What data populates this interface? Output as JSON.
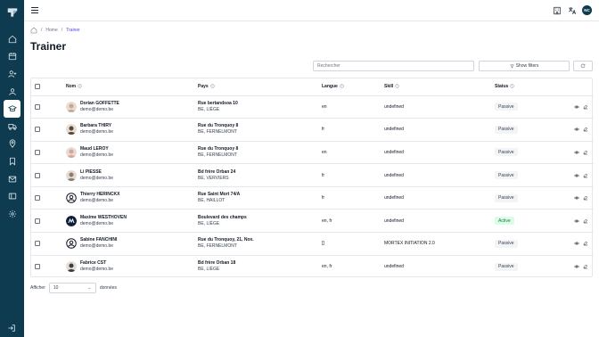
{
  "breadcrumb": {
    "home": "Home",
    "current": "Trainer"
  },
  "page": {
    "title": "Trainer"
  },
  "toolbar": {
    "search_placeholder": "Rechercher",
    "filters_label": "Show filters"
  },
  "table": {
    "columns": {
      "name": "Nom",
      "country": "Pays",
      "language": "Langue",
      "skill": "Skill",
      "status": "Status"
    },
    "rows": [
      {
        "name": "Dorian GOFFETTE",
        "email": "demo@demo.be",
        "addr1": "Rue bertandsoa 10",
        "addr2": "BE, LIÈGE",
        "language": "en",
        "skill": "undefined",
        "status": "Passive",
        "avatar": "photo",
        "avatar_color": "#c9a78f"
      },
      {
        "name": "Barbara THIRY",
        "email": "demo@demo.be",
        "addr1": "Rue du Tronquoy 8",
        "addr2": "BE, FERNELMONT",
        "language": "fr",
        "skill": "undefined",
        "status": "Passive",
        "avatar": "photo",
        "avatar_color": "#5b4636"
      },
      {
        "name": "Maud LEROY",
        "email": "demo@demo.be",
        "addr1": "Rue du Tronquoy 8",
        "addr2": "BE, FERNELMONT",
        "language": "en",
        "skill": "undefined",
        "status": "Passive",
        "avatar": "photo",
        "avatar_color": "#d9a39a"
      },
      {
        "name": "Li PIESSE",
        "email": "demo@demo.be",
        "addr1": "Bd frère Orban 24",
        "addr2": "BE, VERVIERS",
        "language": "fr",
        "skill": "undefined",
        "status": "Passive",
        "avatar": "photo",
        "avatar_color": "#8a7f72"
      },
      {
        "name": "Thierry HERINCKX",
        "email": "demo@demo.be",
        "addr1": "Rue Saint Mort 74/A",
        "addr2": "BE, HAILLOT",
        "language": "fr",
        "skill": "undefined",
        "status": "Passive",
        "avatar": "placeholder",
        "avatar_color": "#111827"
      },
      {
        "name": "Maxime WESTHOVEN",
        "email": "demo@demo.be",
        "addr1": "Boulevard des champs",
        "addr2": "BE, LIÈGE",
        "language": "en, fr",
        "skill": "undefined",
        "status": "Active",
        "avatar": "logo",
        "avatar_color": "#0f1d3a"
      },
      {
        "name": "Sabine FANCHINI",
        "email": "demo@demo.be",
        "addr1": "Rue du Tronquoy, 21, Nox.",
        "addr2": "BE, FERNELMONT",
        "language": "[]",
        "skill": "MORTEX INITIATION 2.0",
        "status": "Passive",
        "avatar": "placeholder",
        "avatar_color": "#111827"
      },
      {
        "name": "Fabrice CST",
        "email": "demo@demo.be",
        "addr1": "Bd frère Orban 18",
        "addr2": "BE, LIÈGE",
        "language": "en, fr",
        "skill": "undefined",
        "status": "Passive",
        "avatar": "photo",
        "avatar_color": "#3b3f45"
      }
    ]
  },
  "footer": {
    "show_label": "Afficher",
    "page_size": "10",
    "entries_label": "données"
  },
  "colors": {
    "sidebar": "#0e3b4f",
    "accent": "#4f46e5",
    "active_badge": "#dcfce7",
    "active_text": "#15803d"
  }
}
